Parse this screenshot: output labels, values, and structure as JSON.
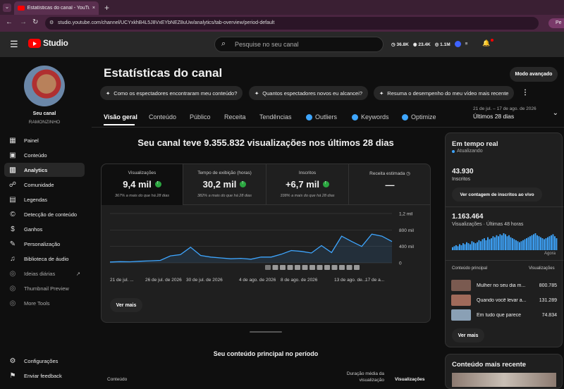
{
  "browser": {
    "tab_title": "Estatísticas do canal - YouTube",
    "url": "studio.youtube.com/channel/UCYxkhB4L5J8VxEYbNEZ8uUw/analytics/tab-overview/period-default",
    "ext1": "36.8K",
    "ext2": "23.4K",
    "ext3": "1.1M",
    "profile": "Pe"
  },
  "header": {
    "brand": "Studio",
    "search_placeholder": "Pesquise no seu canal"
  },
  "channel": {
    "label": "Seu canal",
    "name": "RAMONZINHO"
  },
  "sidebar": {
    "items": [
      {
        "label": "Painel",
        "icon": "dashboard-icon"
      },
      {
        "label": "Conteúdo",
        "icon": "content-icon"
      },
      {
        "label": "Analytics",
        "icon": "analytics-icon"
      },
      {
        "label": "Comunidade",
        "icon": "community-icon"
      },
      {
        "label": "Legendas",
        "icon": "subtitles-icon"
      },
      {
        "label": "Detecção de conteúdo",
        "icon": "copyright-icon"
      },
      {
        "label": "Ganhos",
        "icon": "earn-icon"
      },
      {
        "label": "Personalização",
        "icon": "customize-icon"
      },
      {
        "label": "Biblioteca de áudio",
        "icon": "audio-library-icon"
      },
      {
        "label": "Ideias diárias",
        "icon": "ideas-icon"
      },
      {
        "label": "Thumbnail Preview",
        "icon": "thumbnail-icon"
      },
      {
        "label": "More Tools",
        "icon": "tools-icon"
      }
    ],
    "settings": "Configurações",
    "feedback": "Enviar feedback"
  },
  "page": {
    "title": "Estatísticas do canal",
    "advanced": "Modo avançado",
    "chips": [
      "Como os espectadores encontraram meu conteúdo?",
      "Quantos espectadores novos eu alcancei?",
      "Resuma o desempenho do meu vídeo mais recente"
    ],
    "tabs": [
      "Visão geral",
      "Conteúdo",
      "Público",
      "Receita",
      "Tendências",
      "Outliers",
      "Keywords",
      "Optimize"
    ],
    "date_range": "21 de jul. – 17 de ago. de 2026",
    "period": "Últimos 28 dias"
  },
  "overview": {
    "headline": "Seu canal teve 9.355.832 visualizações nos últimos 28 dias",
    "see_more": "Ver mais",
    "metrics": [
      {
        "label": "Visualizações",
        "value": "9,4 mil",
        "sub": "367% a mais do que há 28 dias"
      },
      {
        "label": "Tempo de exibição (horas)",
        "value": "30,2 mil",
        "sub": "382% a mais do que há 28 dias"
      },
      {
        "label": "Inscritos",
        "value": "+6,7 mil",
        "sub": "338% a mais do que há 28 dias"
      },
      {
        "label": "Receita estimada",
        "value": "—",
        "sub": ""
      }
    ]
  },
  "chart_data": {
    "type": "area",
    "x": [
      "21 de jul. ...",
      "26 de jul. de 2026",
      "30 de jul. de 2026",
      "4 de ago. de 2026",
      "8 de ago. de 2026",
      "13 de ago. de...",
      "17 de a..."
    ],
    "y_ticks": [
      "1,2 mil",
      "800 mil",
      "400 mil",
      "0"
    ],
    "values": [
      20,
      30,
      25,
      40,
      50,
      60,
      170,
      200,
      380,
      180,
      140,
      120,
      100,
      110,
      90,
      140,
      140,
      210,
      300,
      280,
      240,
      420,
      250,
      650,
      520,
      400,
      700,
      650,
      520
    ],
    "ylim": [
      0,
      1200
    ],
    "series_color": "#3ea6ff"
  },
  "realtime": {
    "title": "Em tempo real",
    "status": "Atualizando",
    "subscribers": "43.930",
    "subscribers_label": "Inscritos",
    "live_btn": "Ver contagem de inscritos ao vivo",
    "views": "1.163.464",
    "views_label": "Visualizações · Últimas 48 horas",
    "now": "Agora",
    "bars": [
      3,
      4,
      5,
      4,
      6,
      5,
      7,
      6,
      8,
      7,
      6,
      9,
      8,
      7,
      8,
      10,
      9,
      11,
      12,
      10,
      13,
      11,
      12,
      14,
      13,
      15,
      14,
      16,
      15,
      17,
      16,
      14,
      15,
      13,
      12,
      11,
      10,
      9,
      8,
      9,
      10,
      11,
      12,
      13,
      14,
      15,
      16,
      17,
      15,
      14,
      13,
      12,
      11,
      12,
      13,
      14,
      15,
      16,
      14,
      12
    ],
    "top_header": "Conteúdo principal",
    "top_views_header": "Visualizações",
    "top": [
      {
        "title": "Mulher no seu dia m...",
        "views": "800.785"
      },
      {
        "title": "Quando você levar a...",
        "views": "131.289"
      },
      {
        "title": "Em tudo que parece",
        "views": "74.834"
      }
    ],
    "see_more": "Ver mais"
  },
  "bottom": {
    "title": "Seu conteúdo principal no período",
    "col_content": "Conteúdo",
    "col_duration": "Duração média da visualização",
    "col_views": "Visualizações",
    "latest": "Conteúdo mais recente"
  }
}
